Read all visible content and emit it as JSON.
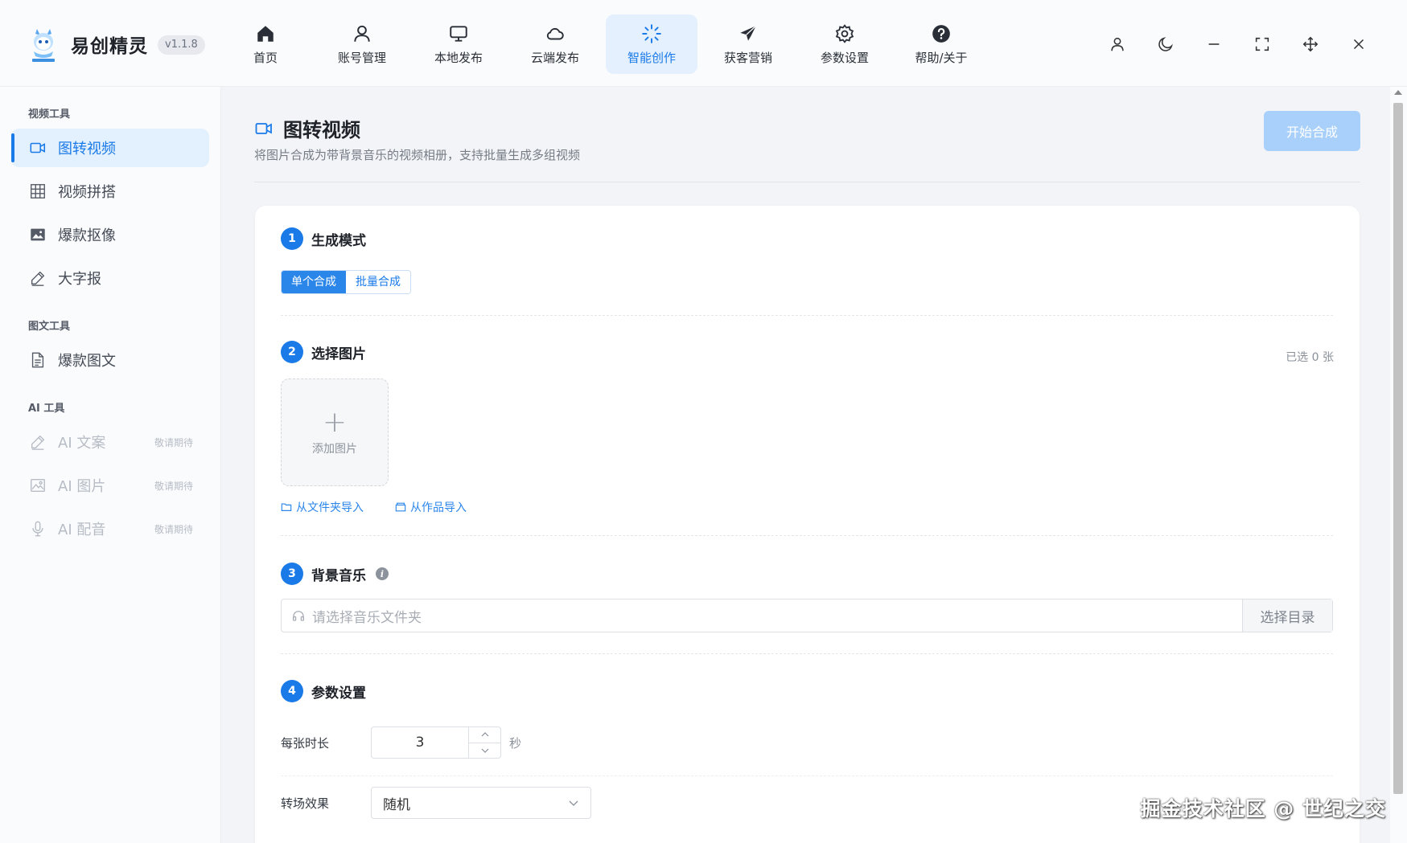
{
  "app": {
    "name": "易创精灵",
    "version": "v1.1.8"
  },
  "nav": [
    {
      "label": "首页",
      "icon": "home-icon"
    },
    {
      "label": "账号管理",
      "icon": "user-icon"
    },
    {
      "label": "本地发布",
      "icon": "monitor-icon"
    },
    {
      "label": "云端发布",
      "icon": "cloud-icon"
    },
    {
      "label": "智能创作",
      "icon": "sparkle-icon",
      "active": true
    },
    {
      "label": "获客营销",
      "icon": "paper-plane-icon"
    },
    {
      "label": "参数设置",
      "icon": "gear-icon"
    },
    {
      "label": "帮助/关于",
      "icon": "help-icon"
    }
  ],
  "window_controls": [
    "user-icon",
    "moon-icon",
    "minimize-icon",
    "fullscreen-icon",
    "move-icon",
    "close-icon"
  ],
  "sidebar": {
    "video_group": "视频工具",
    "video_items": [
      {
        "label": "图转视频",
        "icon": "video-camera-icon",
        "active": true
      },
      {
        "label": "视频拼搭",
        "icon": "grid-icon"
      },
      {
        "label": "爆款抠像",
        "icon": "image-icon"
      },
      {
        "label": "大字报",
        "icon": "pen-icon"
      }
    ],
    "text_group": "图文工具",
    "text_items": [
      {
        "label": "爆款图文",
        "icon": "document-icon"
      }
    ],
    "ai_group": "AI 工具",
    "ai_items": [
      {
        "label": "AI 文案",
        "icon": "pen-icon",
        "badge": "敬请期待"
      },
      {
        "label": "AI 图片",
        "icon": "image-icon",
        "badge": "敬请期待"
      },
      {
        "label": "AI 配音",
        "icon": "microphone-icon",
        "badge": "敬请期待"
      }
    ]
  },
  "page": {
    "title": "图转视频",
    "description": "将图片合成为带背景音乐的视频相册，支持批量生成多组视频",
    "start_button": "开始合成"
  },
  "sections": {
    "mode": {
      "step": "1",
      "title": "生成模式",
      "options": [
        "单个合成",
        "批量合成"
      ],
      "selected": "单个合成"
    },
    "images": {
      "step": "2",
      "title": "选择图片",
      "count_label": "已选 0 张",
      "add_label": "添加图片",
      "import_folder": "从文件夹导入",
      "import_works": "从作品导入"
    },
    "music": {
      "step": "3",
      "title": "背景音乐",
      "placeholder": "请选择音乐文件夹",
      "pick_button": "选择目录"
    },
    "params": {
      "step": "4",
      "title": "参数设置",
      "duration_label": "每张时长",
      "duration_value": "3",
      "duration_unit": "秒",
      "transition_label": "转场效果",
      "transition_value": "随机"
    }
  },
  "watermark": "掘金技术社区 @ 世纪之交",
  "colors": {
    "accent": "#1a7ae8",
    "accent_light": "#e3f0fd",
    "button_disabled": "#a9d0fb"
  }
}
